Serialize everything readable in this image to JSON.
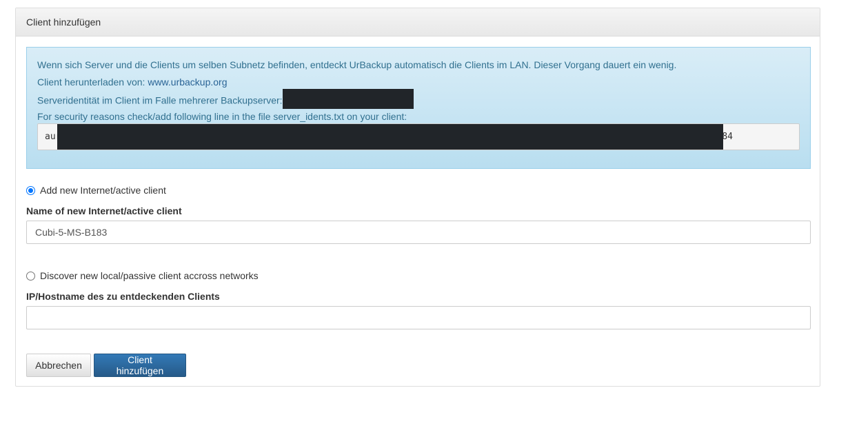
{
  "panel": {
    "title": "Client hinzufügen"
  },
  "info": {
    "line1": "Wenn sich Server und die Clients um selben Subnetz befinden, entdeckt UrBackup automatisch die Clients im LAN. Dieser Vorgang dauert ein wenig.",
    "download_label": "Client herunterladen von: ",
    "download_link": "www.urbackup.org",
    "identity_label": "Serveridentität im Client im Falle mehrerer Backupserver:",
    "security_line": "For security reasons check/add following line in the file server_idents.txt on your client:",
    "code_start": "aur",
    "code_end": "84"
  },
  "internet_client": {
    "radio_label": "Add new Internet/active client",
    "checked": true,
    "field_label": "Name of new Internet/active client",
    "value": "Cubi-5-MS-B183"
  },
  "local_client": {
    "radio_label": "Discover new local/passive client accross networks",
    "checked": false,
    "field_label": "IP/Hostname des zu entdeckenden Clients",
    "value": ""
  },
  "buttons": {
    "cancel": "Abbrechen",
    "submit": "Client hinzufügen"
  },
  "colors": {
    "info_text": "#31708f",
    "primary": "#337ab7",
    "radio_checked": "#0075ff"
  }
}
